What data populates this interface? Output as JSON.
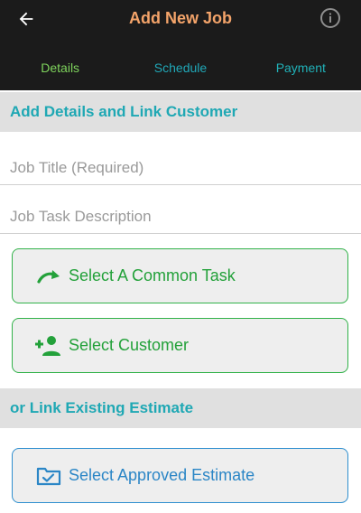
{
  "header": {
    "title": "Add New Job",
    "back_icon": "arrow-left-icon",
    "info_icon": "info-icon"
  },
  "tabs": [
    {
      "label": "Details",
      "active": true
    },
    {
      "label": "Schedule",
      "active": false
    },
    {
      "label": "Payment",
      "active": false
    }
  ],
  "sections": {
    "details_header": "Add Details and Link Customer",
    "estimate_header": "or Link Existing Estimate"
  },
  "fields": {
    "job_title": {
      "placeholder": "Job Title (Required)",
      "value": ""
    },
    "job_description": {
      "placeholder": "Job Task Description",
      "value": ""
    }
  },
  "buttons": {
    "common_task": {
      "label": "Select A Common Task",
      "icon": "redo-arrow-icon"
    },
    "customer": {
      "label": "Select Customer",
      "icon": "add-person-icon"
    },
    "estimate": {
      "label": "Select Approved Estimate",
      "icon": "folder-check-icon"
    }
  },
  "colors": {
    "title": "#f4a46a",
    "active_tab": "#7ed35c",
    "teal": "#1fa8b4",
    "green": "#23a13a",
    "blue": "#2b86c6"
  }
}
